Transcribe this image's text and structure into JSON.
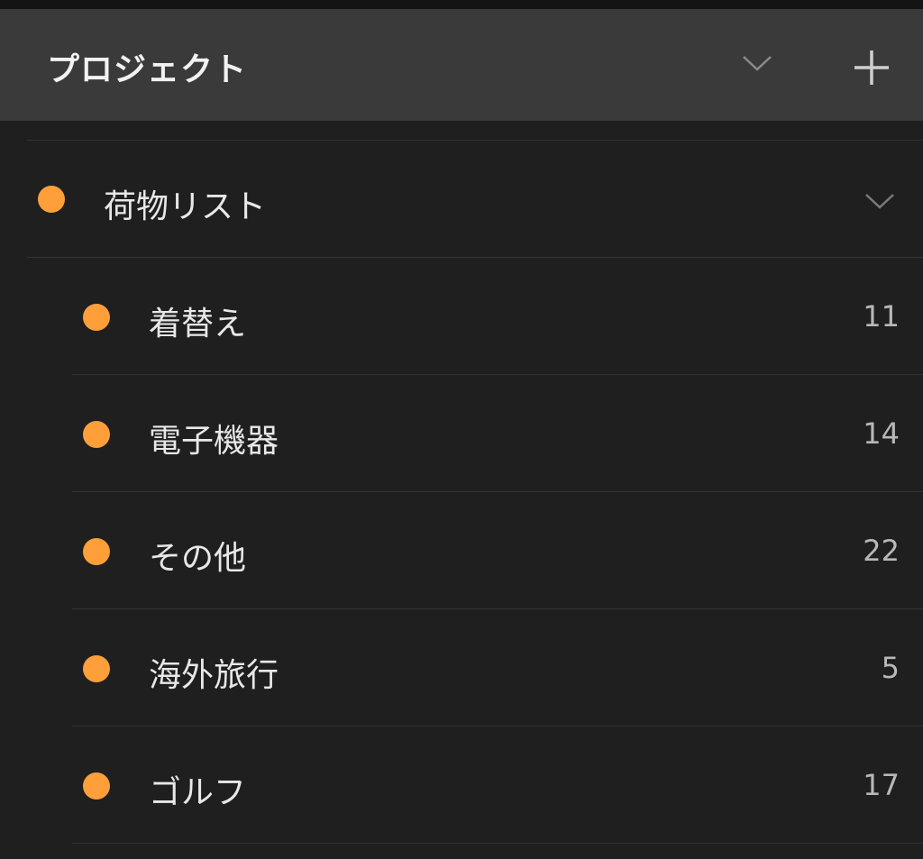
{
  "header": {
    "title": "プロジェクト",
    "collapse_icon": "chevron-down-icon",
    "add_icon": "plus-icon"
  },
  "colors": {
    "accent_dot": "#ff9f3a",
    "header_bg": "#3a3a3a",
    "list_bg": "#1f1f1f"
  },
  "projects": {
    "parent": {
      "label": "荷物リスト",
      "expand_icon": "chevron-down-icon"
    },
    "children": [
      {
        "label": "着替え",
        "count": "11"
      },
      {
        "label": "電子機器",
        "count": "14"
      },
      {
        "label": "その他",
        "count": "22"
      },
      {
        "label": "海外旅行",
        "count": "5"
      },
      {
        "label": "ゴルフ",
        "count": "17"
      }
    ]
  }
}
